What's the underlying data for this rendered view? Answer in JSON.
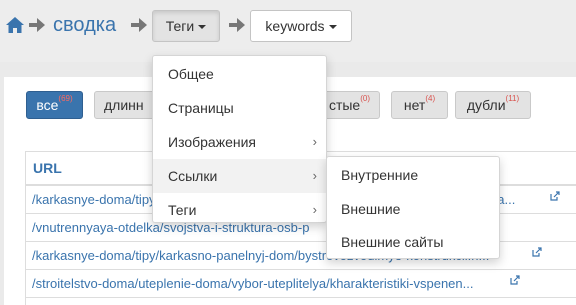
{
  "breadcrumb": {
    "current": "сводка"
  },
  "toolbar": {
    "tags_label": "Теги",
    "keywords_label": "keywords"
  },
  "filters": [
    {
      "label": "все",
      "count": "(69)"
    },
    {
      "label": "длинн",
      "count": ""
    },
    {
      "label": "стые",
      "count": "(0)"
    },
    {
      "label": "нет",
      "count": "(4)"
    },
    {
      "label": "дубли",
      "count": "(11)"
    }
  ],
  "table": {
    "header": "URL",
    "rows": [
      "/karkasnye-doma/tipy/karkasno-panelnyj-dom/bystrovozvodimye-konstrukcii-doma...",
      "/vnutrennyaya-otdelka/svojstva-i-struktura-osb-p",
      "/karkasnye-doma/tipy/karkasno-panelnyj-dom/bystrovozvodimye-konstrukcii.h...",
      "/stroitelstvo-doma/uteplenie-doma/vybor-uteplitelya/kharakteristiki-vspenen..."
    ]
  },
  "menu": {
    "items": [
      {
        "label": "Общее"
      },
      {
        "label": "Страницы"
      },
      {
        "label": "Изображения"
      },
      {
        "label": "Ссылки"
      },
      {
        "label": "Теги"
      }
    ]
  },
  "submenu": {
    "items": [
      {
        "label": "Внутренние"
      },
      {
        "label": "Внешние"
      },
      {
        "label": "Внешние сайты"
      }
    ]
  },
  "icons": {
    "home": "home-icon",
    "arrow": "arrow-right-icon",
    "external": "external-link-icon",
    "chevron": "chevron-right-icon"
  },
  "colors": {
    "accent": "#3a74ad",
    "badge": "#d9534f"
  }
}
